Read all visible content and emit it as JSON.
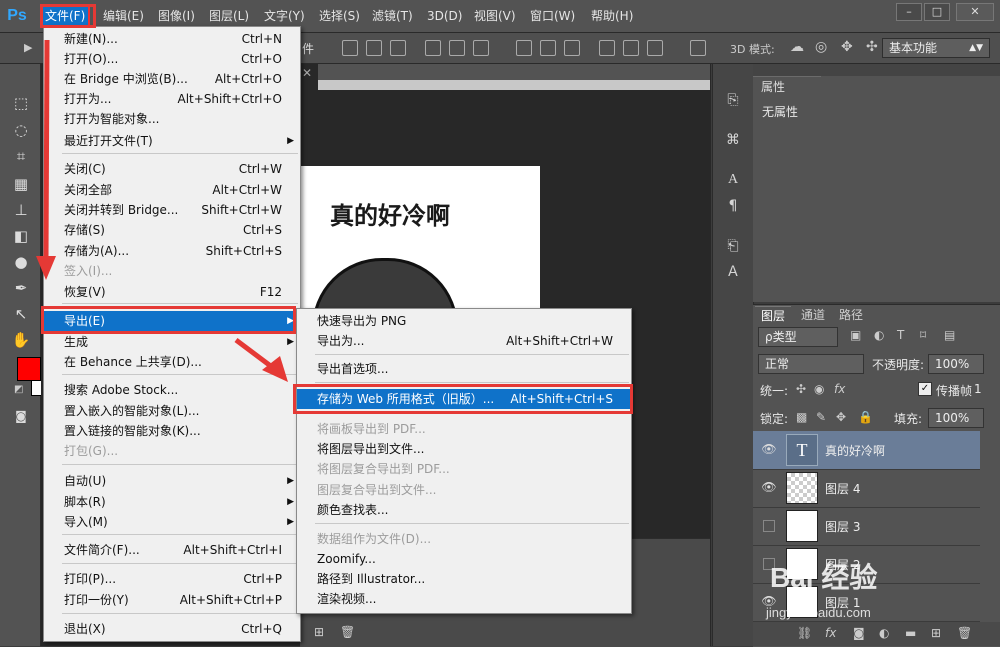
{
  "app": {
    "logo": "Ps"
  },
  "menubar": {
    "items": [
      "文件(F)",
      "编辑(E)",
      "图像(I)",
      "图层(L)",
      "文字(Y)",
      "选择(S)",
      "滤镜(T)",
      "3D(D)",
      "视图(V)",
      "窗口(W)",
      "帮助(H)"
    ],
    "active_index": 0,
    "window_buttons": [
      "–",
      "□",
      "✕"
    ]
  },
  "optionsbar": {
    "fragment": "件",
    "label_3d": "3D 模式:",
    "workspace": "基本功能"
  },
  "canvas": {
    "title": "真的好冷啊",
    "tab_close": "✕"
  },
  "file_menu": {
    "items": [
      {
        "label": "新建(N)...",
        "shortcut": "Ctrl+N"
      },
      {
        "label": "打开(O)...",
        "shortcut": "Ctrl+O"
      },
      {
        "label": "在 Bridge 中浏览(B)...",
        "shortcut": "Alt+Ctrl+O"
      },
      {
        "label": "打开为...",
        "shortcut": "Alt+Shift+Ctrl+O"
      },
      {
        "label": "打开为智能对象...",
        "shortcut": ""
      },
      {
        "label": "最近打开文件(T)",
        "shortcut": "",
        "submenu": true
      },
      {
        "label": "关闭(C)",
        "shortcut": "Ctrl+W"
      },
      {
        "label": "关闭全部",
        "shortcut": "Alt+Ctrl+W"
      },
      {
        "label": "关闭并转到 Bridge...",
        "shortcut": "Shift+Ctrl+W"
      },
      {
        "label": "存储(S)",
        "shortcut": "Ctrl+S"
      },
      {
        "label": "存储为(A)...",
        "shortcut": "Shift+Ctrl+S"
      },
      {
        "label": "签入(I)...",
        "shortcut": "",
        "disabled": true
      },
      {
        "label": "恢复(V)",
        "shortcut": "F12"
      },
      {
        "label": "导出(E)",
        "shortcut": "",
        "submenu": true,
        "highlighted": true
      },
      {
        "label": "生成",
        "shortcut": "",
        "submenu": true
      },
      {
        "label": "在 Behance 上共享(D)...",
        "shortcut": ""
      },
      {
        "label": "搜索 Adobe Stock...",
        "shortcut": ""
      },
      {
        "label": "置入嵌入的智能对象(L)...",
        "shortcut": ""
      },
      {
        "label": "置入链接的智能对象(K)...",
        "shortcut": ""
      },
      {
        "label": "打包(G)...",
        "shortcut": "",
        "disabled": true
      },
      {
        "label": "自动(U)",
        "shortcut": "",
        "submenu": true
      },
      {
        "label": "脚本(R)",
        "shortcut": "",
        "submenu": true
      },
      {
        "label": "导入(M)",
        "shortcut": "",
        "submenu": true
      },
      {
        "label": "文件简介(F)...",
        "shortcut": "Alt+Shift+Ctrl+I"
      },
      {
        "label": "打印(P)...",
        "shortcut": "Ctrl+P"
      },
      {
        "label": "打印一份(Y)",
        "shortcut": "Alt+Shift+Ctrl+P"
      },
      {
        "label": "退出(X)",
        "shortcut": "Ctrl+Q"
      }
    ]
  },
  "export_menu": {
    "items": [
      {
        "label": "快速导出为 PNG",
        "shortcut": ""
      },
      {
        "label": "导出为...",
        "shortcut": "Alt+Shift+Ctrl+W"
      },
      {
        "label": "导出首选项...",
        "shortcut": ""
      },
      {
        "label": "存储为 Web 所用格式（旧版）...",
        "shortcut": "Alt+Shift+Ctrl+S",
        "highlighted": true
      },
      {
        "label": "将画板导出到 PDF...",
        "shortcut": "",
        "disabled": true
      },
      {
        "label": "将图层导出到文件...",
        "shortcut": ""
      },
      {
        "label": "将图层复合导出到 PDF...",
        "shortcut": "",
        "disabled": true
      },
      {
        "label": "图层复合导出到文件...",
        "shortcut": "",
        "disabled": true
      },
      {
        "label": "颜色查找表...",
        "shortcut": ""
      },
      {
        "label": "数据组作为文件(D)...",
        "shortcut": "",
        "disabled": true
      },
      {
        "label": "Zoomify...",
        "shortcut": ""
      },
      {
        "label": "路径到 Illustrator...",
        "shortcut": ""
      },
      {
        "label": "渲染视频...",
        "shortcut": ""
      }
    ]
  },
  "properties": {
    "tab": "属性",
    "body": "无属性"
  },
  "layers_panel": {
    "tabs": [
      "图层",
      "通道",
      "路径"
    ],
    "filter": "ρ类型",
    "blend_mode": "正常",
    "opacity_label": "不透明度:",
    "opacity": "100%",
    "unify_label": "统一:",
    "propagate_label": "传播帧",
    "propagate_value": "1",
    "lock_label": "锁定:",
    "fill_label": "填充:",
    "fill": "100%",
    "layers": [
      {
        "name": "真的好冷啊",
        "visible": true,
        "selected": true,
        "kind": "text",
        "thumb_glyph": "T"
      },
      {
        "name": "图层 4",
        "visible": true,
        "selected": false,
        "kind": "raster"
      },
      {
        "name": "图层 3",
        "visible": false,
        "selected": false,
        "kind": "raster"
      },
      {
        "name": "图层 2",
        "visible": false,
        "selected": false,
        "kind": "raster"
      },
      {
        "name": "图层 1",
        "visible": true,
        "selected": false,
        "kind": "raster"
      }
    ]
  },
  "colors": {
    "foreground": "#ff0000",
    "background": "#ffffff",
    "menu_highlight": "#0f72c9",
    "annotation": "#e53935"
  },
  "watermark": {
    "brand": "Bai 经验",
    "url": "jingyan.baidu.com"
  }
}
